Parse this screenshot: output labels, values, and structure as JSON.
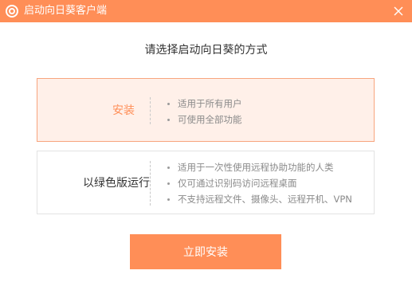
{
  "window": {
    "title": "启动向日葵客户端",
    "accent_color": "#ff8e57"
  },
  "heading": "请选择启动向日葵的方式",
  "options": [
    {
      "label": "安装",
      "selected": true,
      "features": [
        "适用于所有用户",
        "可使用全部功能"
      ]
    },
    {
      "label": "以绿色版运行",
      "selected": false,
      "features": [
        "适用于一次性使用远程协助功能的人类",
        "仅可通过识别码访问远程桌面",
        "不支持远程文件、摄像头、远程开机、VPN"
      ]
    }
  ],
  "primary_button": "立即安装"
}
